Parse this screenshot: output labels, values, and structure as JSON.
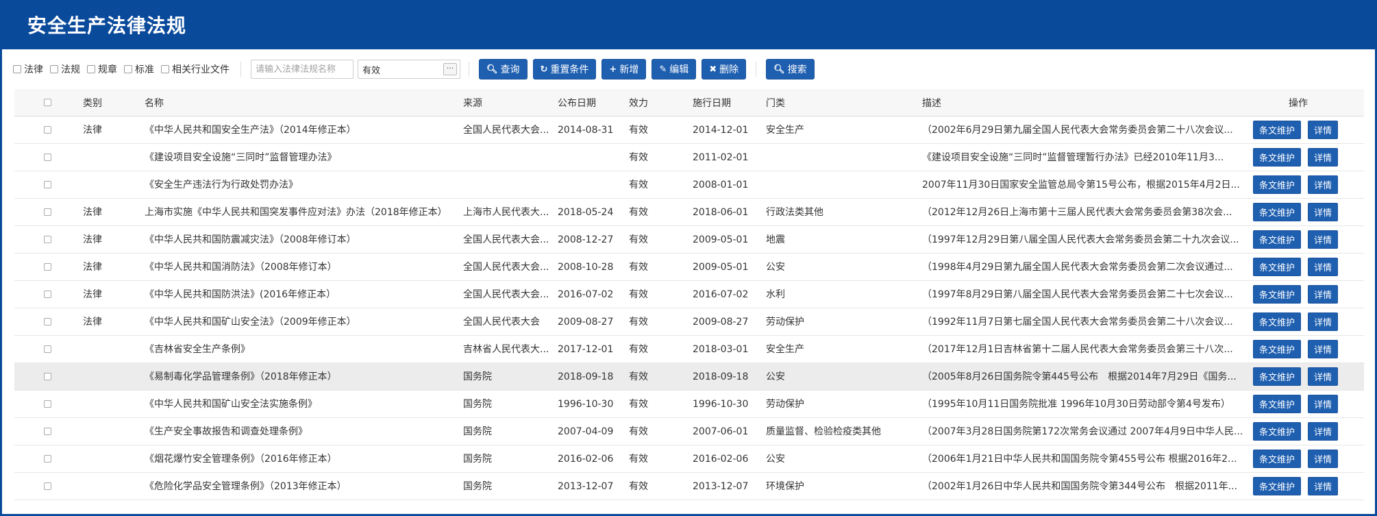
{
  "header": {
    "title": "安全生产法律法规"
  },
  "filters": {
    "checkboxes": [
      {
        "label": "法律"
      },
      {
        "label": "法规"
      },
      {
        "label": "规章"
      },
      {
        "label": "标准"
      },
      {
        "label": "相关行业文件"
      }
    ],
    "name_placeholder": "请输入法律法规名称",
    "effect_value": "有效",
    "effect_btn": "···"
  },
  "toolbar": {
    "query": "查询",
    "reset": "重置条件",
    "add": "新增",
    "edit": "编辑",
    "delete": "删除",
    "search": "搜索"
  },
  "table": {
    "columns": {
      "type": "类别",
      "name": "名称",
      "source": "来源",
      "publish_date": "公布日期",
      "effect": "效力",
      "impl_date": "施行日期",
      "category": "门类",
      "desc": "描述",
      "ops": "操作"
    },
    "op_labels": {
      "maintain": "条文维护",
      "detail": "详情"
    },
    "rows": [
      {
        "type": "法律",
        "name": "《中华人民共和国安全生产法》（2014年修正本）",
        "source": "全国人民代表大会...",
        "publish_date": "2014-08-31",
        "effect": "有效",
        "impl_date": "2014-12-01",
        "category": "安全生产",
        "desc": "（2002年6月29日第九届全国人民代表大会常务委员会第二十八次会议..."
      },
      {
        "type": "",
        "name": "《建设项目安全设施“三同时”监督管理办法》",
        "source": "",
        "publish_date": "",
        "effect": "有效",
        "impl_date": "2011-02-01",
        "category": "",
        "desc": "《建设项目安全设施“三同时”监督管理暂行办法》已经2010年11月3..."
      },
      {
        "type": "",
        "name": "《安全生产违法行为行政处罚办法》",
        "source": "",
        "publish_date": "",
        "effect": "有效",
        "impl_date": "2008-01-01",
        "category": "",
        "desc": "2007年11月30日国家安全监管总局令第15号公布，根据2015年4月2日..."
      },
      {
        "type": "法律",
        "name": "上海市实施《中华人民共和国突发事件应对法》办法（2018年修正本）",
        "source": "上海市人民代表大...",
        "publish_date": "2018-05-24",
        "effect": "有效",
        "impl_date": "2018-06-01",
        "category": "行政法类其他",
        "desc": "（2012年12月26日上海市第十三届人民代表大会常务委员会第38次会..."
      },
      {
        "type": "法律",
        "name": "《中华人民共和国防震减灾法》（2008年修订本）",
        "source": "全国人民代表大会...",
        "publish_date": "2008-12-27",
        "effect": "有效",
        "impl_date": "2009-05-01",
        "category": "地震",
        "desc": "（1997年12月29日第八届全国人民代表大会常务委员会第二十九次会议..."
      },
      {
        "type": "法律",
        "name": "《中华人民共和国消防法》（2008年修订本）",
        "source": "全国人民代表大会...",
        "publish_date": "2008-10-28",
        "effect": "有效",
        "impl_date": "2009-05-01",
        "category": "公安",
        "desc": "（1998年4月29日第九届全国人民代表大会常务委员会第二次会议通过..."
      },
      {
        "type": "法律",
        "name": "《中华人民共和国防洪法》(2016年修正本）",
        "source": "全国人民代表大会...",
        "publish_date": "2016-07-02",
        "effect": "有效",
        "impl_date": "2016-07-02",
        "category": "水利",
        "desc": "（1997年8月29日第八届全国人民代表大会常务委员会第二十七次会议..."
      },
      {
        "type": "法律",
        "name": "《中华人民共和国矿山安全法》（2009年修正本）",
        "source": "全国人民代表大会",
        "publish_date": "2009-08-27",
        "effect": "有效",
        "impl_date": "2009-08-27",
        "category": "劳动保护",
        "desc": "（1992年11月7日第七届全国人民代表大会常务委员会第二十八次会议..."
      },
      {
        "type": "",
        "name": "《吉林省安全生产条例》",
        "source": "吉林省人民代表大...",
        "publish_date": "2017-12-01",
        "effect": "有效",
        "impl_date": "2018-03-01",
        "category": "安全生产",
        "desc": "（2017年12月1日吉林省第十二届人民代表大会常务委员会第三十八次..."
      },
      {
        "type": "",
        "name": "《易制毒化学品管理条例》（2018年修正本）",
        "source": "国务院",
        "publish_date": "2018-09-18",
        "effect": "有效",
        "impl_date": "2018-09-18",
        "category": "公安",
        "desc": "（2005年8月26日国务院令第445号公布　根据2014年7月29日《国务..."
      },
      {
        "type": "",
        "name": "《中华人民共和国矿山安全法实施条例》",
        "source": "国务院",
        "publish_date": "1996-10-30",
        "effect": "有效",
        "impl_date": "1996-10-30",
        "category": "劳动保护",
        "desc": "（1995年10月11日国务院批准 1996年10月30日劳动部令第4号发布）"
      },
      {
        "type": "",
        "name": "《生产安全事故报告和调查处理条例》",
        "source": "国务院",
        "publish_date": "2007-04-09",
        "effect": "有效",
        "impl_date": "2007-06-01",
        "category": "质量监督、检验检疫类其他",
        "desc": "（2007年3月28日国务院第172次常务会议通过 2007年4月9日中华人民..."
      },
      {
        "type": "",
        "name": "《烟花爆竹安全管理条例》（2016年修正本）",
        "source": "国务院",
        "publish_date": "2016-02-06",
        "effect": "有效",
        "impl_date": "2016-02-06",
        "category": "公安",
        "desc": "（2006年1月21日中华人民共和国国务院令第455号公布 根据2016年2..."
      },
      {
        "type": "",
        "name": "《危险化学品安全管理条例》（2013年修正本）",
        "source": "国务院",
        "publish_date": "2013-12-07",
        "effect": "有效",
        "impl_date": "2013-12-07",
        "category": "环境保护",
        "desc": "（2002年1月26日中华人民共和国国务院令第344号公布　根据2011年..."
      }
    ]
  }
}
